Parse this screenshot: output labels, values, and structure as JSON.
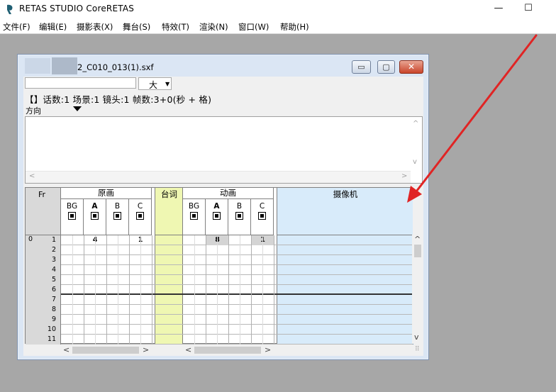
{
  "app": {
    "title": "RETAS STUDIO CoreRETAS",
    "minimize_glyph": "—",
    "maximize_glyph": "☐"
  },
  "menu": [
    "文件(F)",
    "编辑(E)",
    "摄影表(X)",
    "舞台(S)",
    "特效(T)",
    "渲染(N)",
    "窗口(W)",
    "帮助(H)"
  ],
  "child_window": {
    "title": "2_C010_013(1).sxf",
    "min_glyph": "▭",
    "max_glyph": "▢",
    "close_glyph": "✕"
  },
  "toolbar": {
    "name_value": "",
    "size_value": "大",
    "info": "【】话数:1 场景:1 镜头:1 帧数:3+0(秒 + 格)",
    "direction_label": "方向"
  },
  "sheet": {
    "fr_label": "Fr",
    "genga_label": "原画",
    "dialog_label": "台词",
    "douga_label": "动画",
    "camera_label": "摄像机",
    "genga_layers": [
      "BG",
      "A",
      "B",
      "C"
    ],
    "douga_layers": [
      "BG",
      "A",
      "B",
      "C"
    ],
    "section_no": "0",
    "frames": [
      "1",
      "2",
      "3",
      "4",
      "5",
      "6",
      "7",
      "8",
      "9",
      "10",
      "11"
    ],
    "genga_cells": {
      "A": "4",
      "C": "1"
    },
    "douga_cells": {
      "A": "8",
      "C": "1"
    }
  },
  "colors": {
    "dialog_column": "#eff7b2",
    "camera_column": "#d8ebfa",
    "annotation_arrow": "#e02424"
  }
}
